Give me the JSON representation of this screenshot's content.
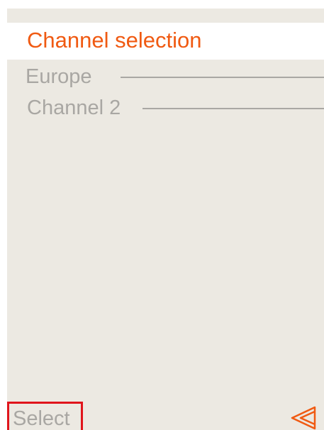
{
  "header": {
    "title": "Channel selection"
  },
  "list": {
    "items": [
      {
        "label": "Europe"
      },
      {
        "label": "Channel 2"
      }
    ]
  },
  "softkeys": {
    "left_label": "Select",
    "right_icon": "back-double-triangle-icon"
  },
  "colors": {
    "accent": "#f05a12",
    "muted_text": "#a9a7a3",
    "background": "#ece9e2",
    "highlight_border": "#e0151c"
  }
}
